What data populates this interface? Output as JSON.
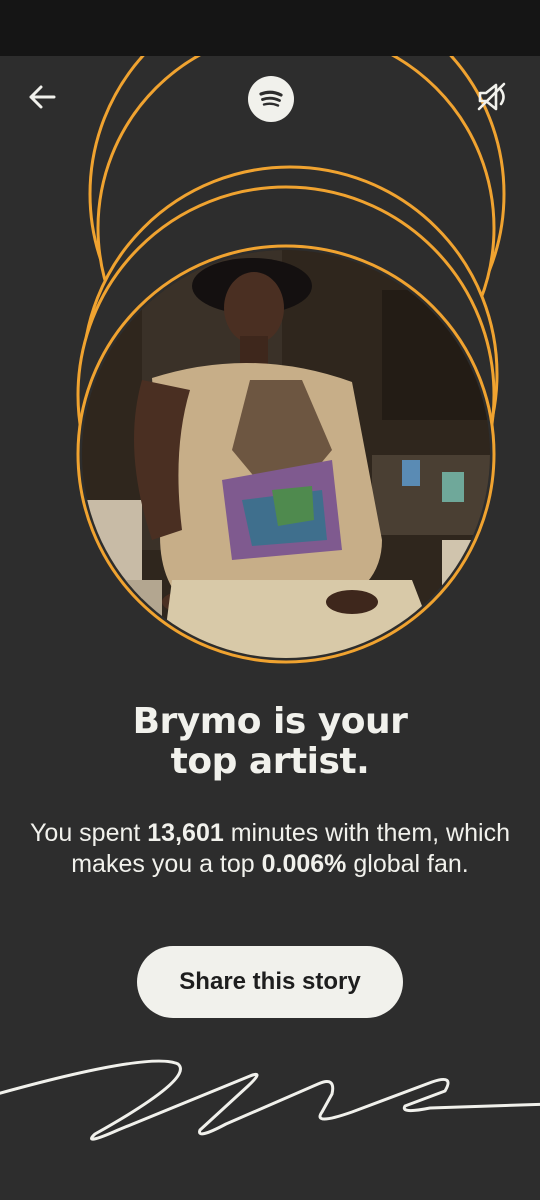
{
  "header": {
    "back_icon": "arrow-left-icon",
    "logo_icon": "spotify-logo-icon",
    "mute_icon": "speaker-muted-icon"
  },
  "headline": {
    "line1": "Brymo is your",
    "line2": "top artist."
  },
  "stats": {
    "part1": "You spent ",
    "minutes": "13,601",
    "part2": " minutes with them, which makes you a top ",
    "percentile": "0.006%",
    "part3": " global fan."
  },
  "share_button": {
    "label": "Share this story"
  },
  "colors": {
    "background": "#2d2d2d",
    "status_bar": "#151515",
    "ring": "#f0a330",
    "text": "#f1f1ec",
    "button_bg": "#f1f1ec",
    "button_text": "#1e1e1e"
  }
}
